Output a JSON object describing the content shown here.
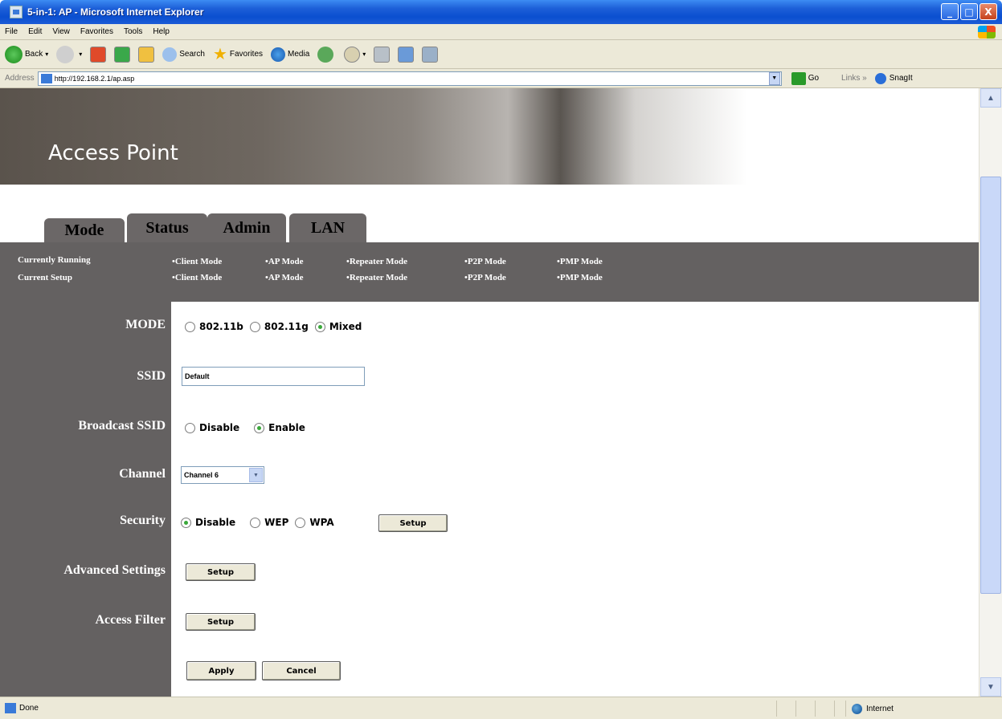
{
  "window": {
    "title": "5-in-1: AP - Microsoft Internet Explorer",
    "controls": [
      "_",
      "□",
      "X"
    ]
  },
  "menubar": [
    "File",
    "Edit",
    "View",
    "Favorites",
    "Tools",
    "Help"
  ],
  "toolbar": {
    "back": "Back",
    "search": "Search",
    "favorites": "Favorites",
    "media": "Media"
  },
  "address": {
    "label": "Address",
    "url": "http://192.168.2.1/ap.asp",
    "go": "Go",
    "links": "Links",
    "snagit": "SnagIt"
  },
  "banner": {
    "title": "Access Point"
  },
  "tabs": [
    "Mode",
    "Status",
    "Admin",
    "LAN"
  ],
  "subnav": {
    "currently_running_label": "Currently Running",
    "current_setup_label": "Current Setup",
    "running": [
      "•Client Mode",
      "•AP Mode",
      "•Repeater Mode",
      "•P2P Mode",
      "•PMP Mode"
    ],
    "setup": [
      "•Client Mode",
      "•AP Mode",
      "•Repeater Mode",
      "•P2P Mode",
      "•PMP Mode"
    ]
  },
  "form": {
    "mode": {
      "label": "MODE",
      "options": [
        "802.11b",
        "802.11g",
        "Mixed"
      ],
      "selected": "Mixed"
    },
    "ssid": {
      "label": "SSID",
      "value": "Default"
    },
    "broadcast": {
      "label": "Broadcast SSID",
      "options": [
        "Disable",
        "Enable"
      ],
      "selected": "Enable"
    },
    "channel": {
      "label": "Channel",
      "value": "Channel 6"
    },
    "security": {
      "label": "Security",
      "options": [
        "Disable",
        "WEP",
        "WPA"
      ],
      "selected": "Disable",
      "setup": "Setup"
    },
    "advanced": {
      "label": "Advanced Settings",
      "setup": "Setup"
    },
    "filter": {
      "label": "Access Filter",
      "setup": "Setup"
    },
    "apply": "Apply",
    "cancel": "Cancel"
  },
  "status": {
    "text": "Done",
    "zone": "Internet"
  }
}
